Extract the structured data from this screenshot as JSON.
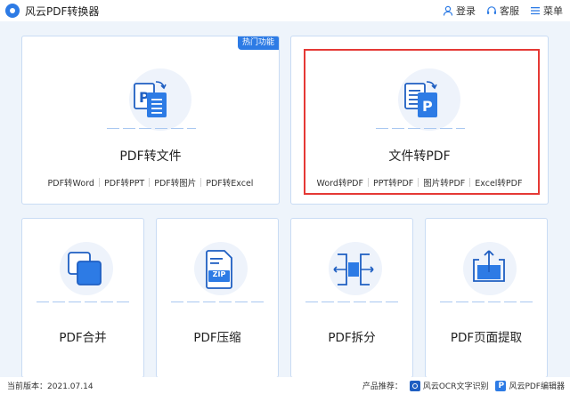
{
  "app": {
    "title": "风云PDF转换器"
  },
  "header": {
    "login": "登录",
    "service": "客服",
    "menu": "菜单"
  },
  "cards": {
    "pdf_to_file": {
      "badge": "热门功能",
      "title": "PDF转文件",
      "links": [
        "PDF转Word",
        "PDF转PPT",
        "PDF转图片",
        "PDF转Excel"
      ]
    },
    "file_to_pdf": {
      "title": "文件转PDF",
      "links": [
        "Word转PDF",
        "PPT转PDF",
        "图片转PDF",
        "Excel转PDF"
      ]
    },
    "merge": {
      "title": "PDF合并"
    },
    "compress": {
      "title": "PDF压缩",
      "icon_text": "ZIP"
    },
    "split": {
      "title": "PDF拆分"
    },
    "extract": {
      "title": "PDF页面提取"
    }
  },
  "status": {
    "version_label": "当前版本：",
    "version": "2021.07.14",
    "recommend_label": "产品推荐：",
    "product_ocr": "风云OCR文字识别",
    "product_editor": "风云PDF编辑器"
  },
  "colors": {
    "accent": "#2d7be5",
    "selection": "#e53935",
    "card_border": "#c9dcf4",
    "background": "#eef4fb"
  }
}
